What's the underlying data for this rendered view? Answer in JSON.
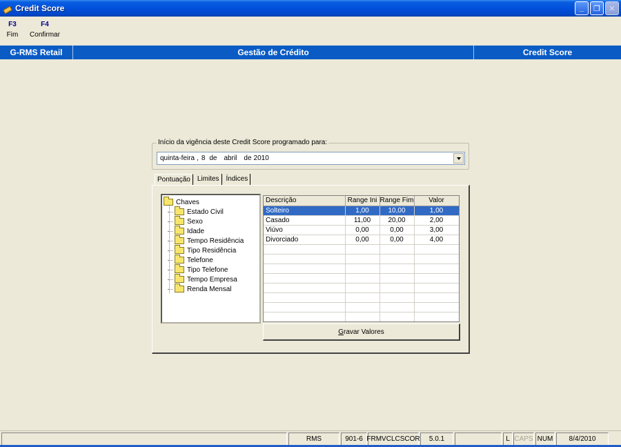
{
  "window": {
    "title": "Credit Score"
  },
  "toolbar": [
    {
      "key": "F3",
      "label": "Fim"
    },
    {
      "key": "F4",
      "label": "Confirmar"
    }
  ],
  "header_band": {
    "left": "G-RMS Retail",
    "center": "Gestão de Crédito",
    "right": "Credit Score"
  },
  "vigencia": {
    "legend": "Início da vigência deste Credit Score programado para:",
    "date": {
      "weekday": "quinta-feira",
      "sep": ",",
      "day": "8",
      "de1": "de",
      "month": "abril",
      "de2": "de",
      "year": "2010"
    }
  },
  "tabs": [
    "Pontuação",
    "Limites",
    "Índices"
  ],
  "active_tab": "Pontuação",
  "tree": {
    "root": "Chaves",
    "children": [
      "Estado Civil",
      "Sexo",
      "Idade",
      "Tempo Residência",
      "Tipo Residência",
      "Telefone",
      "Tipo Telefone",
      "Tempo Empresa",
      "Renda Mensal"
    ]
  },
  "grid": {
    "columns": [
      "Descrição",
      "Range Ini",
      "Range Fim",
      "Valor"
    ],
    "rows": [
      [
        "Solteiro",
        "1,00",
        "10,00",
        "1,00"
      ],
      [
        "Casado",
        "11,00",
        "20,00",
        "2,00"
      ],
      [
        "Viúvo",
        "0,00",
        "0,00",
        "3,00"
      ],
      [
        "Divorciado",
        "0,00",
        "0,00",
        "4,00"
      ]
    ],
    "selected_row": 0
  },
  "gravar_button": {
    "accel": "G",
    "rest": "ravar Valores"
  },
  "statusbar": {
    "panels": [
      "RMS",
      "901-6",
      "FRMVCLCSCOR",
      "5.0.1",
      "L",
      "CAPS",
      "NUM",
      "8/4/2010"
    ]
  }
}
